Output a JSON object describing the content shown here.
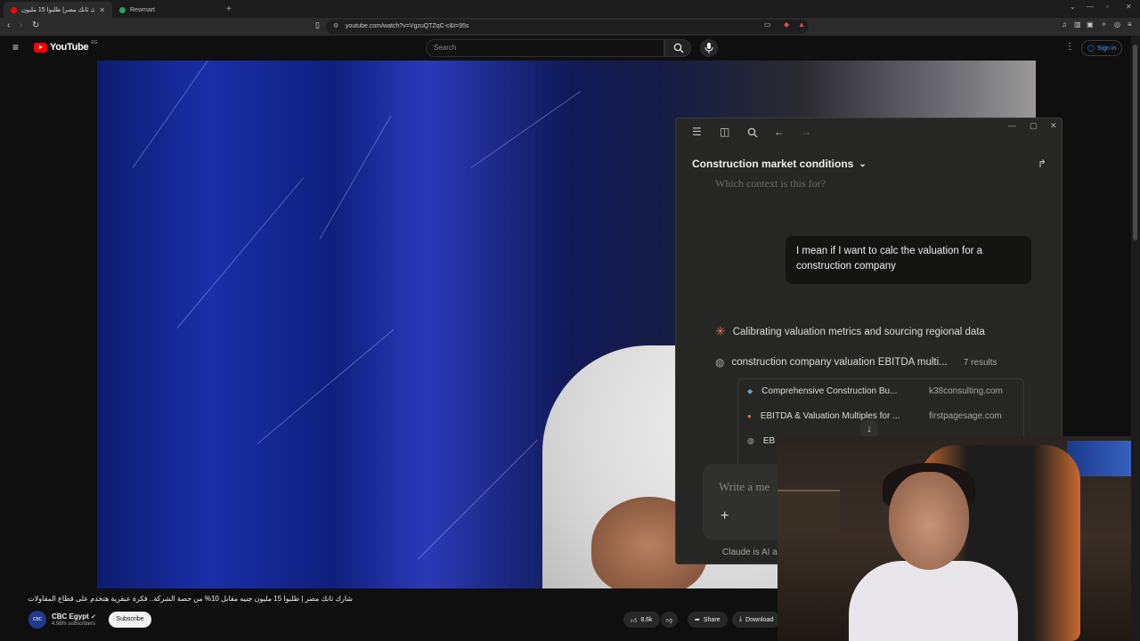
{
  "browser": {
    "tabs": [
      {
        "title": "شارك ثانك مصر| طلبوا 15 مليون",
        "active": true
      },
      {
        "title": "Rewmart",
        "active": false
      }
    ],
    "url": "youtube.com/watch?v=VgzuQTZqC-c&t=95s"
  },
  "youtube": {
    "logo_text": "YouTube",
    "country_code": "EG",
    "search_placeholder": "Search",
    "sign_in": "Sign in",
    "video_title": "شارك ثانك مصر | طلبوا 15 مليون جنيه مقابل 10% من حصة الشركة.. فكرة عبقرية هتخدم على قطاع المقاولات",
    "channel_name": "CBC Egypt",
    "channel_avatar_text": "CBC",
    "channel_subs": "4.98m subscribers",
    "subscribe_label": "Subscribe",
    "likes": "8.6k",
    "share_label": "Share",
    "download_label": "Download"
  },
  "claude": {
    "title": "Construction market conditions",
    "faded_text": "Which context is this for?",
    "user_message": "I mean if I want to calc the valuation for a construction company",
    "status_line": "Calibrating valuation metrics and sourcing regional data",
    "search_query": "construction company valuation EBITDA multi...",
    "results_count": "7 results",
    "results": [
      {
        "title": "Comprehensive Construction Bu...",
        "source": "k38consulting.com"
      },
      {
        "title": "EBITDA & Valuation Multiples for ...",
        "source": "firstpagesage.com"
      },
      {
        "title": "EB",
        "source": ""
      }
    ],
    "input_placeholder": "Write a me",
    "footer": "Claude is AI a"
  },
  "colors": {
    "yt_red": "#ff0000",
    "claude_bg": "#262624",
    "claude_accent": "#d97757",
    "link_blue": "#3ea6ff"
  }
}
